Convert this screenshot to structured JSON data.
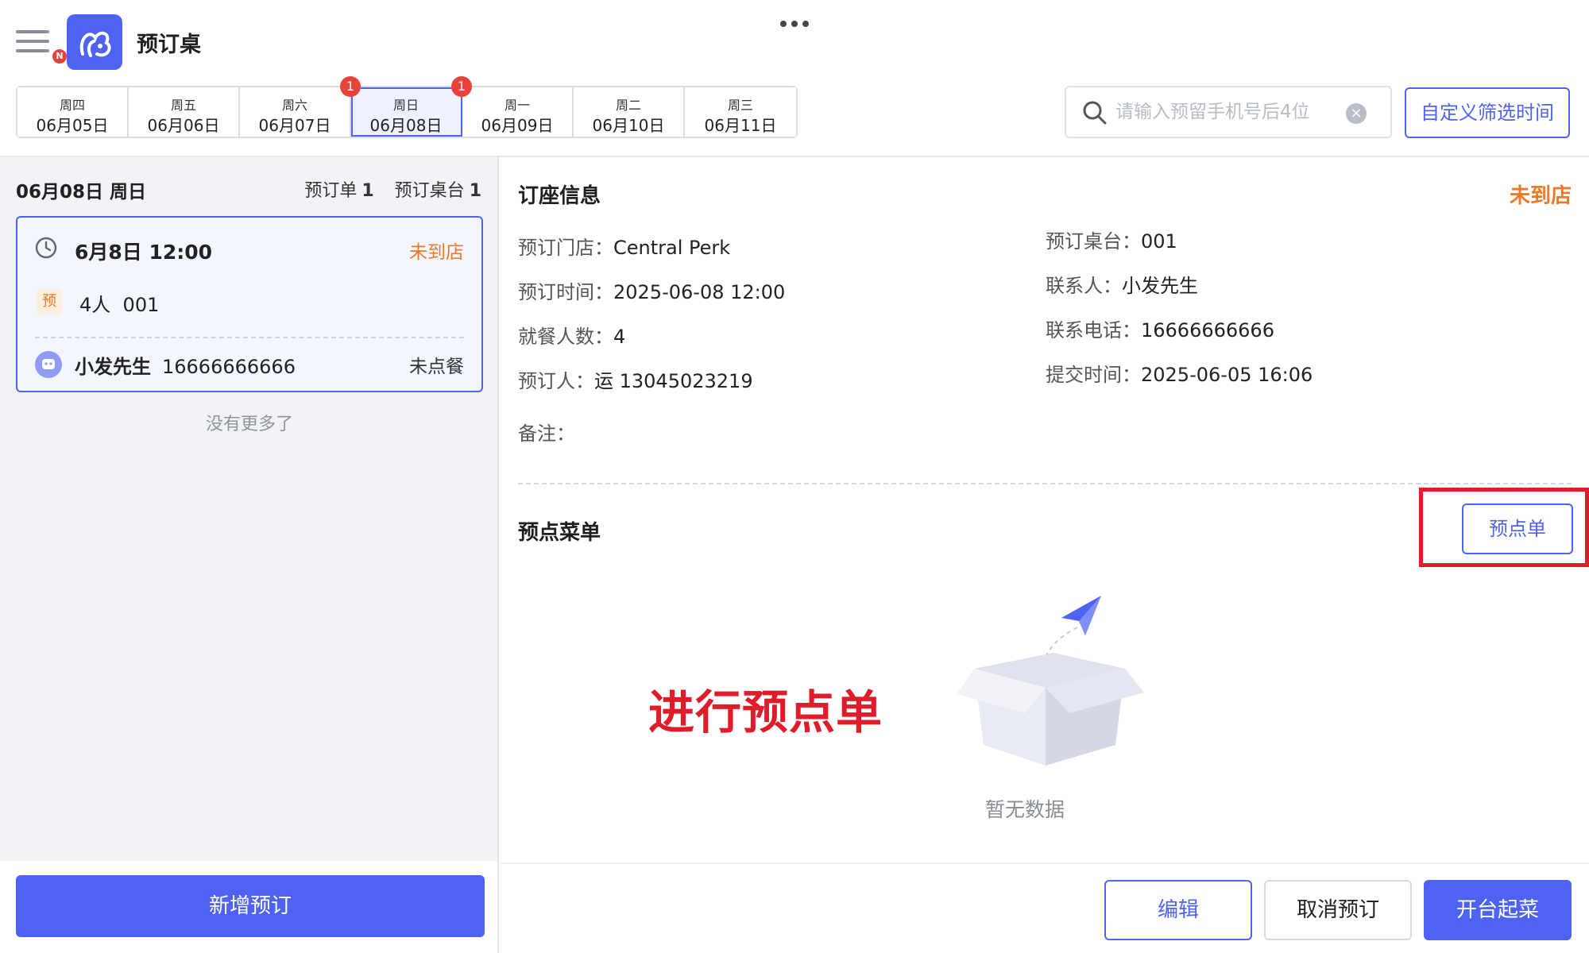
{
  "colors": {
    "accent": "#4f63f2",
    "status_orange": "#ea7a2a",
    "alert_red": "#e01b2a"
  },
  "header": {
    "app_title": "预订桌",
    "menu_badge": "N",
    "icons": [
      "menu-icon",
      "app-logo-icon",
      "more-icon"
    ]
  },
  "date_tabs": [
    {
      "weekday": "周四",
      "date": "06月05日",
      "badge": ""
    },
    {
      "weekday": "周五",
      "date": "06月06日",
      "badge": ""
    },
    {
      "weekday": "周六",
      "date": "06月07日",
      "badge": "1"
    },
    {
      "weekday": "周日",
      "date": "06月08日",
      "badge": "1",
      "active": true
    },
    {
      "weekday": "周一",
      "date": "06月09日",
      "badge": ""
    },
    {
      "weekday": "周二",
      "date": "06月10日",
      "badge": ""
    },
    {
      "weekday": "周三",
      "date": "06月11日",
      "badge": ""
    }
  ],
  "search": {
    "placeholder": "请输入预留手机号后4位",
    "value": "",
    "clear_icon": "×"
  },
  "custom_time_button": "自定义筛选时间",
  "left": {
    "date_heading": "06月08日 周日",
    "orders_label": "预订单",
    "orders_count": "1",
    "tables_label": "预订桌台",
    "tables_count": "1",
    "card": {
      "time": "6月8日 12:00",
      "status": "未到店",
      "badge": "预",
      "guests": "4人",
      "table": "001",
      "contact_name": "小发先生",
      "contact_phone": "16666666666",
      "order_status": "未点餐"
    },
    "no_more": "没有更多了",
    "new_booking_button": "新增预订"
  },
  "right": {
    "info_title": "订座信息",
    "info_status": "未到店",
    "fields": {
      "store": {
        "label": "预订门店：",
        "value": "Central Perk"
      },
      "time": {
        "label": "预订时间：",
        "value": "2025-06-08 12:00"
      },
      "guests": {
        "label": "就餐人数：",
        "value": "4"
      },
      "booker": {
        "label": "预订人：",
        "value": "运 13045023219"
      },
      "remark": {
        "label": "备注：",
        "value": ""
      },
      "table": {
        "label": "预订桌台：",
        "value": "001"
      },
      "contact": {
        "label": "联系人：",
        "value": "小发先生"
      },
      "phone": {
        "label": "联系电话：",
        "value": "16666666666"
      },
      "submitted": {
        "label": "提交时间：",
        "value": "2025-06-05 16:06"
      }
    },
    "menu_title": "预点菜单",
    "preorder_button": "预点单",
    "annotation": "进行预点单",
    "empty_text": "暂无数据",
    "buttons": {
      "edit": "编辑",
      "cancel": "取消预订",
      "open": "开台起菜"
    }
  }
}
